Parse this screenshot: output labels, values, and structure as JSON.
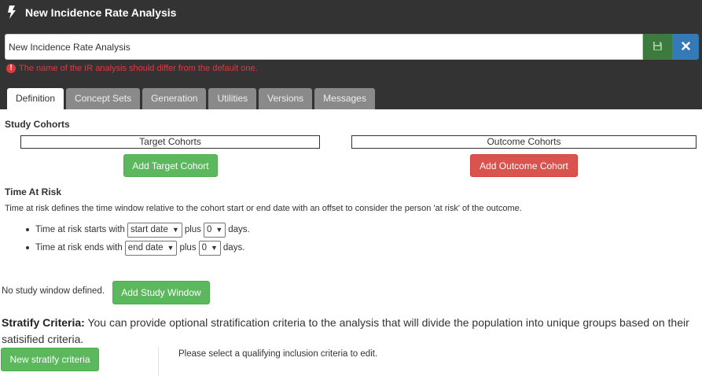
{
  "header": {
    "title": "New Incidence Rate Analysis",
    "icon": "bolt-icon"
  },
  "name_field": {
    "value": "New Incidence Rate Analysis",
    "warning": "The name of the IR analysis should differ from the default one."
  },
  "tabs": [
    {
      "label": "Definition",
      "active": true
    },
    {
      "label": "Concept Sets",
      "active": false
    },
    {
      "label": "Generation",
      "active": false
    },
    {
      "label": "Utilities",
      "active": false
    },
    {
      "label": "Versions",
      "active": false
    },
    {
      "label": "Messages",
      "active": false
    }
  ],
  "study_cohorts": {
    "heading": "Study Cohorts",
    "target_label": "Target Cohorts",
    "outcome_label": "Outcome Cohorts",
    "add_target": "Add Target Cohort",
    "add_outcome": "Add Outcome Cohort"
  },
  "time_at_risk": {
    "heading": "Time At Risk",
    "description": "Time at risk defines the time window relative to the cohort start or end date with an offset to consider the person 'at risk' of the outcome.",
    "start": {
      "prefix": "Time at risk starts with",
      "date_option": "start date",
      "plus": "plus",
      "offset": "0",
      "suffix": "days."
    },
    "end": {
      "prefix": "Time at risk ends with",
      "date_option": "end date",
      "plus": "plus",
      "offset": "0",
      "suffix": "days."
    }
  },
  "study_window": {
    "text": "No study window defined.",
    "button": "Add Study Window"
  },
  "stratify": {
    "label": "Stratify Criteria:",
    "description": " You can provide optional stratification criteria to the analysis that will divide the population into unique groups based on their satisified criteria.",
    "button": "New stratify criteria",
    "hint": "Please select a qualifying inclusion criteria to edit."
  },
  "colors": {
    "header_bg": "#333333",
    "success": "#5cb85c",
    "danger": "#d9534f",
    "primary": "#337ab7",
    "warning_text": "#e0393e"
  }
}
